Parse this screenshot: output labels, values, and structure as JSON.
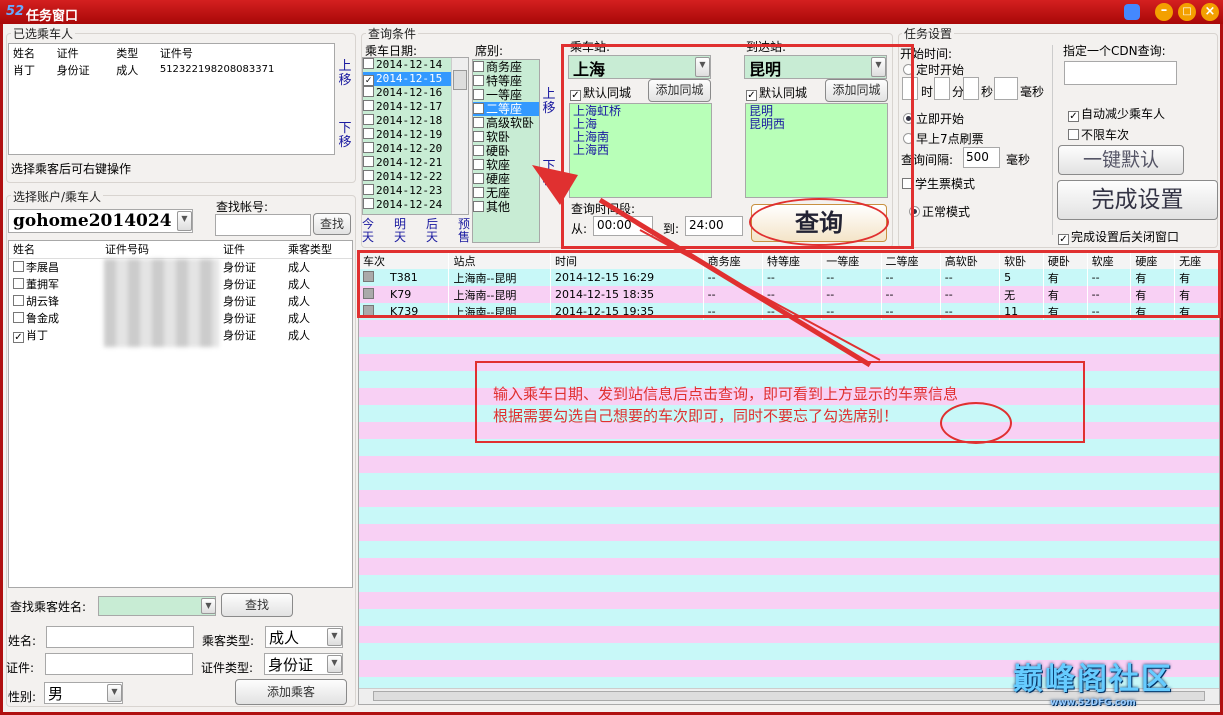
{
  "window": {
    "title": "任务窗口",
    "logo": "52"
  },
  "selected_passengers": {
    "legend": "已选乘车人",
    "columns": [
      "姓名",
      "证件",
      "类型",
      "证件号"
    ],
    "rows": [
      [
        "肖丁",
        "身份证",
        "成人",
        "512322198208083371"
      ]
    ],
    "up": "上移",
    "down": "下移",
    "hint": "选择乘客后可右键操作"
  },
  "account": {
    "legend": "选择账户/乘车人",
    "account_value": "gohome2014024",
    "find_label": "查找帐号:",
    "find_button": "查找",
    "columns": [
      "姓名",
      "证件号码",
      "证件",
      "乘客类型"
    ],
    "rows": [
      {
        "name": "李展昌",
        "id_type": "身份证",
        "type": "成人",
        "checked": false
      },
      {
        "name": "董拥军",
        "id_type": "身份证",
        "type": "成人",
        "checked": false
      },
      {
        "name": "胡云锋",
        "id_type": "身份证",
        "type": "成人",
        "checked": false
      },
      {
        "name": "鲁金成",
        "id_type": "身份证",
        "type": "成人",
        "checked": false
      },
      {
        "name": "肖丁",
        "id_type": "身份证",
        "type": "成人",
        "checked": true
      }
    ]
  },
  "add_passenger": {
    "search_label": "查找乘客姓名:",
    "search_button": "查找",
    "name_label": "姓名:",
    "type_label": "乘客类型:",
    "type_value": "成人",
    "id_label": "证件:",
    "id_type_label": "证件类型:",
    "id_type_value": "身份证",
    "gender_label": "性别:",
    "gender_value": "男",
    "add_button": "添加乘客"
  },
  "query": {
    "legend": "查询条件",
    "date_label": "乘车日期:",
    "dates": [
      "2014-12-14",
      "2014-12-15",
      "2014-12-16",
      "2014-12-17",
      "2014-12-18",
      "2014-12-19",
      "2014-12-20",
      "2014-12-21",
      "2014-12-22",
      "2014-12-23",
      "2014-12-24"
    ],
    "checked_date": "2014-12-15",
    "quick": [
      "今天",
      "明天",
      "后天",
      "预售"
    ],
    "seat_label": "席别:",
    "seats": [
      "商务座",
      "特等座",
      "一等座",
      "二等座",
      "高级软卧",
      "软卧",
      "硬卧",
      "软座",
      "硬座",
      "无座",
      "其他"
    ],
    "selected_seat": "二等座",
    "up": "上移",
    "down": "下移",
    "from_label": "乘车站:",
    "from_value": "上海",
    "to_label": "到达站:",
    "to_value": "昆明",
    "same_city": "默认同城",
    "add_same_city": "添加同城",
    "from_stations": [
      "上海虹桥",
      "上海",
      "上海南",
      "上海西"
    ],
    "to_stations": [
      "昆明",
      "昆明西"
    ],
    "period_label": "查询时间段:",
    "from_time_label": "从:",
    "from_time": "00:00",
    "to_time_label": "到:",
    "to_time": "24:00",
    "query_button": "查询"
  },
  "task": {
    "legend": "任务设置",
    "start_label": "开始时间:",
    "timed": "定时开始",
    "h": "时",
    "m": "分",
    "s": "秒",
    "ms": "毫秒",
    "now": "立即开始",
    "seven": "早上7点刷票",
    "interval_label": "查询间隔:",
    "interval": "500",
    "interval_unit": "毫秒",
    "student": "学生票模式",
    "normal": "正常模式",
    "cdn_label": "指定一个CDN查询:",
    "auto_reduce": "自动减少乘车人",
    "no_limit": "不限车次",
    "default_button": "一键默认",
    "finish_button": "完成设置",
    "close_after": "完成设置后关闭窗口"
  },
  "results": {
    "columns": [
      "车次",
      "站点",
      "时间",
      "商务座",
      "特等座",
      "一等座",
      "二等座",
      "高软卧",
      "软卧",
      "硬卧",
      "软座",
      "硬座",
      "无座"
    ],
    "rows": [
      [
        "T381",
        "上海南--昆明",
        "2014-12-15   16:29",
        "--",
        "--",
        "--",
        "--",
        "--",
        "5",
        "有",
        "--",
        "有",
        "有"
      ],
      [
        "K79",
        "上海南--昆明",
        "2014-12-15   18:35",
        "--",
        "--",
        "--",
        "--",
        "--",
        "无",
        "有",
        "--",
        "有",
        "有"
      ],
      [
        "K739",
        "上海南--昆明",
        "2014-12-15   19:35",
        "--",
        "--",
        "--",
        "--",
        "--",
        "11",
        "有",
        "--",
        "有",
        "有"
      ]
    ]
  },
  "annotation": {
    "line1": "输入乘车日期、发到站信息后点击查询，即可看到上方显示的车票信息",
    "line2": "根据需要勾选自己想要的车次即可，同时不要忘了勾选席别！"
  },
  "watermark": {
    "text": "巅峰阁社区",
    "url": "www.52DFG.com"
  },
  "colors": {
    "title": "#c01010",
    "accent": "#e03030",
    "green": "#c8ecd4",
    "row_pink": "#f8d0f4",
    "row_cyan": "#c8f8f8"
  }
}
